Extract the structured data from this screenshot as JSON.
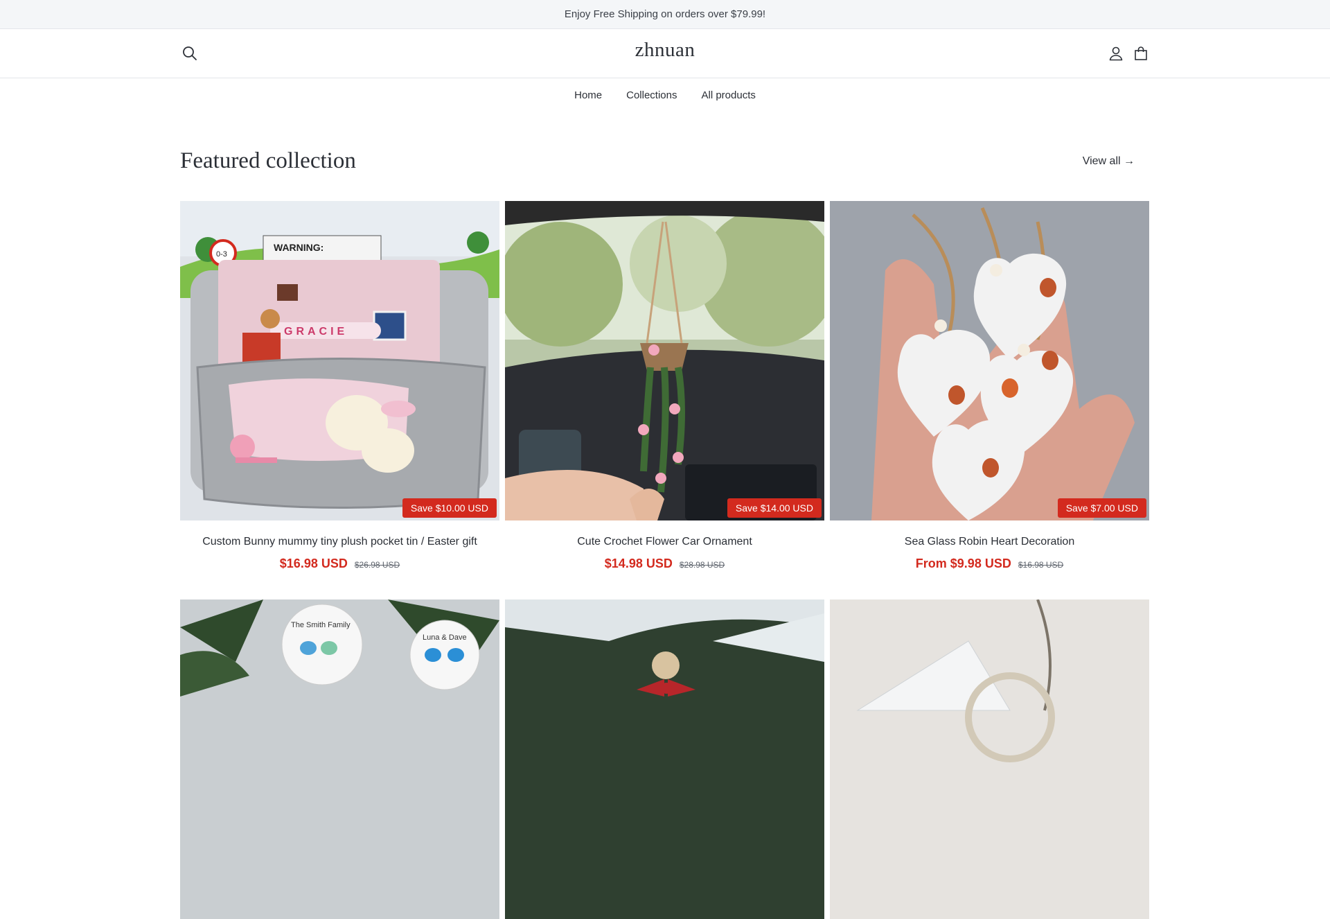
{
  "announcement": {
    "text": "Enjoy Free Shipping on orders over $79.99!"
  },
  "header": {
    "logo": "zhnuan",
    "search_icon": "search-icon",
    "account_icon": "user-icon",
    "cart_icon": "bag-icon"
  },
  "nav": {
    "items": [
      "Home",
      "Collections",
      "All products"
    ]
  },
  "featured": {
    "title": "Featured collection",
    "view_all": "View all →"
  },
  "products": [
    {
      "title": "Custom Bunny mummy tiny plush pocket tin / Easter gift",
      "price": "$16.98 USD",
      "compare": "$26.98 USD",
      "badge": "Save $10.00 USD"
    },
    {
      "title": "Cute Crochet Flower Car Ornament",
      "price": "$14.98 USD",
      "compare": "$28.98 USD",
      "badge": "Save $14.00 USD"
    },
    {
      "title": "Sea Glass Robin Heart Decoration",
      "price": "From $9.98 USD",
      "compare": "$16.98 USD",
      "badge": "Save $7.00 USD"
    }
  ],
  "product_image_texts": {
    "warning": "WARNING:",
    "age": "0-3",
    "name": "GRACIE",
    "ornament_1": "The Smith Family",
    "ornament_2": "Luna & Dave"
  },
  "colors": {
    "sale": "#d32a1e",
    "text": "#2b2f36",
    "announcement_bg": "#f4f6f8"
  }
}
